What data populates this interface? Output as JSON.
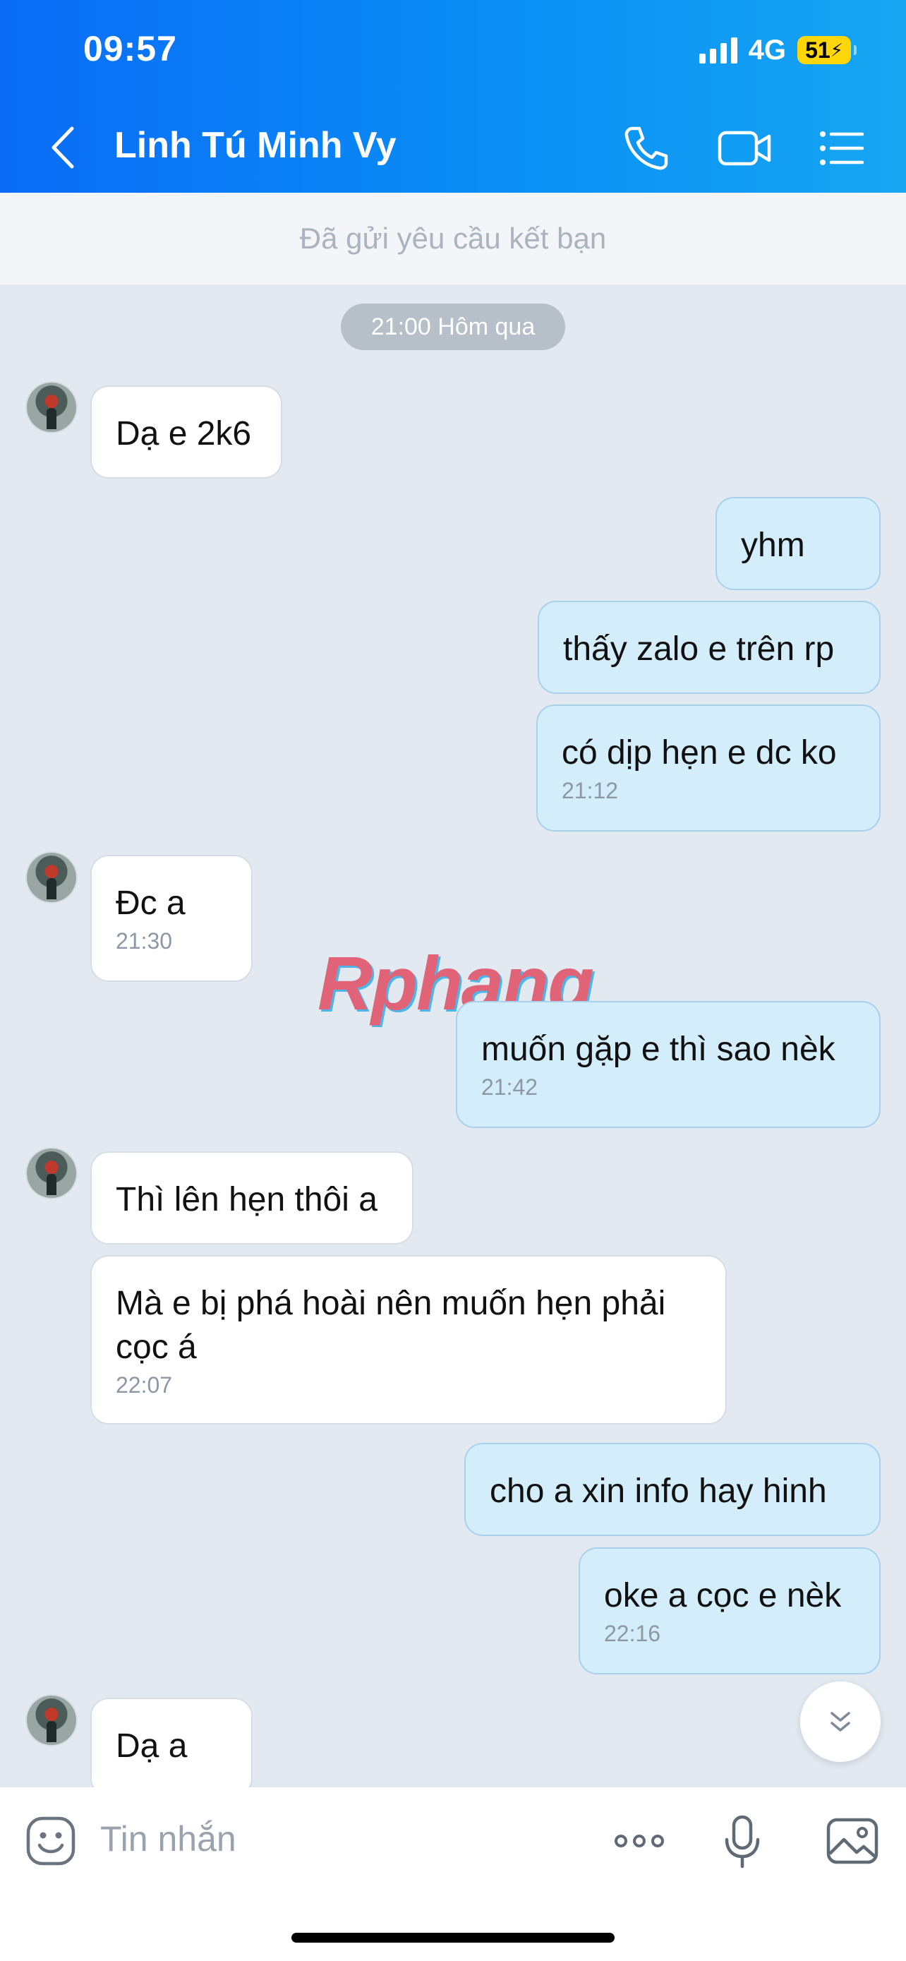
{
  "status_bar": {
    "time": "09:57",
    "network": "4G",
    "battery": "51"
  },
  "header": {
    "title": "Linh Tú Minh Vy"
  },
  "friend_request": {
    "text": "Đã gửi yêu cầu kết bạn"
  },
  "date_chip": "21:00 Hôm qua",
  "messages": [
    {
      "dir": "in",
      "text": "Dạ e 2k6",
      "time": ""
    },
    {
      "dir": "out",
      "text": "yhm",
      "time": ""
    },
    {
      "dir": "out",
      "text": "thấy zalo e trên rp",
      "time": ""
    },
    {
      "dir": "out",
      "text": "có dịp hẹn e dc ko",
      "time": "21:12"
    },
    {
      "dir": "in",
      "text": "Đc a",
      "time": "21:30"
    },
    {
      "dir": "out",
      "text": "muốn gặp e thì sao nèk",
      "time": "21:42"
    },
    {
      "dir": "in",
      "text": "Thì lên hẹn thôi a",
      "time": ""
    },
    {
      "dir": "in",
      "text": "Mà e bị phá hoài nên muốn hẹn phải cọc á",
      "time": "22:07"
    },
    {
      "dir": "out",
      "text": "cho a xin  info hay hinh",
      "time": ""
    },
    {
      "dir": "out",
      "text": "oke a cọc e nèk",
      "time": "22:16"
    },
    {
      "dir": "in",
      "text": "Dạ a",
      "time": ""
    }
  ],
  "watermark": "Rphang",
  "input": {
    "placeholder": "Tin nhắn"
  },
  "icons": {
    "back": "chevron-left-icon",
    "call": "phone-icon",
    "video": "video-camera-icon",
    "menu": "list-icon",
    "emoji": "emoji-icon",
    "more": "more-dots-icon",
    "mic": "microphone-icon",
    "image": "image-icon",
    "scroll": "chevron-down-icon"
  },
  "colors": {
    "header": "#0a8ef5",
    "bubble_out": "#d3edfb",
    "bubble_in": "#ffffff",
    "chat_bg": "#e2e9f1"
  }
}
